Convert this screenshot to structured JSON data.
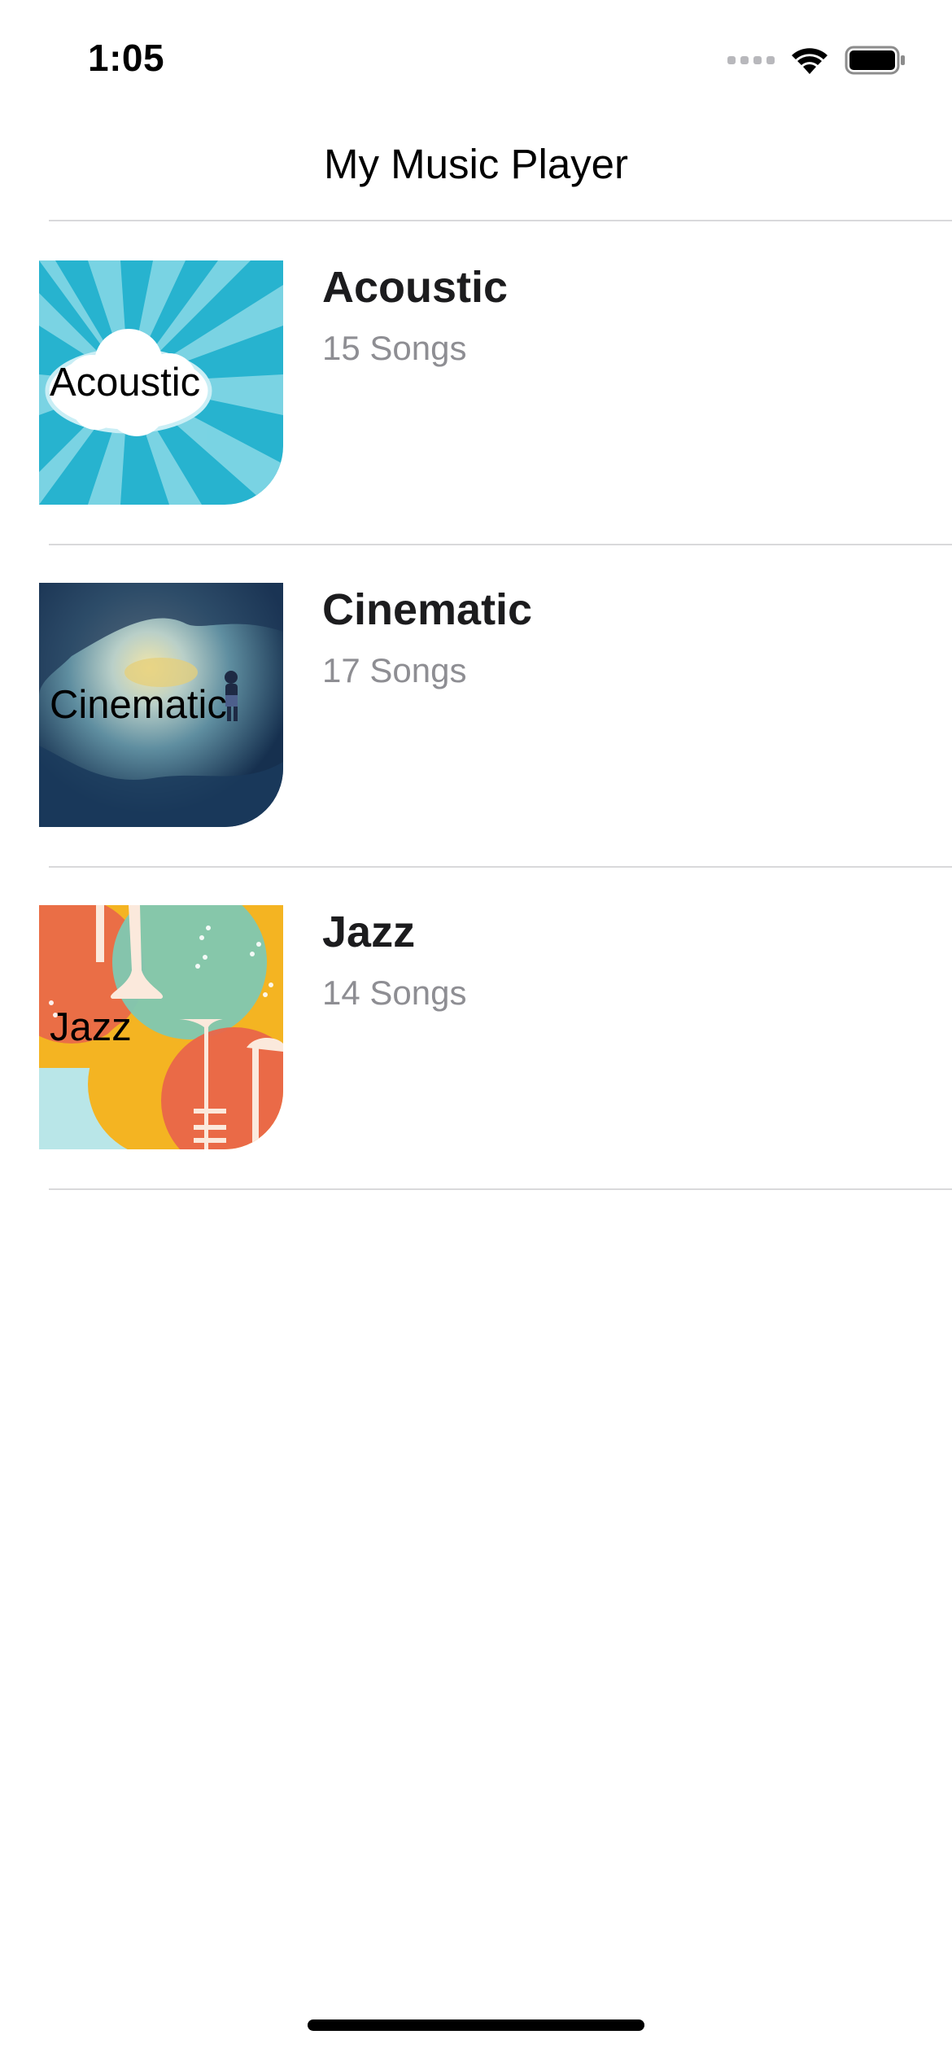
{
  "status_bar": {
    "time": "1:05",
    "icons": [
      "signal-icon",
      "wifi-icon",
      "battery-icon"
    ]
  },
  "nav": {
    "title": "My Music Player"
  },
  "playlists": [
    {
      "title": "Acoustic",
      "subtitle": "15 Songs",
      "artwork_label": "Acoustic",
      "artwork_colors": [
        "#27b3cf",
        "#8fdbe8",
        "#ffffff"
      ]
    },
    {
      "title": "Cinematic",
      "subtitle": "17 Songs",
      "artwork_label": "Cinematic",
      "artwork_colors": [
        "#16304f",
        "#7fa8b3",
        "#f2e6a8"
      ]
    },
    {
      "title": "Jazz",
      "subtitle": "14 Songs",
      "artwork_label": "Jazz",
      "artwork_colors": [
        "#f4b422",
        "#e9664a",
        "#7fc8b2",
        "#b9e6e8"
      ]
    }
  ]
}
